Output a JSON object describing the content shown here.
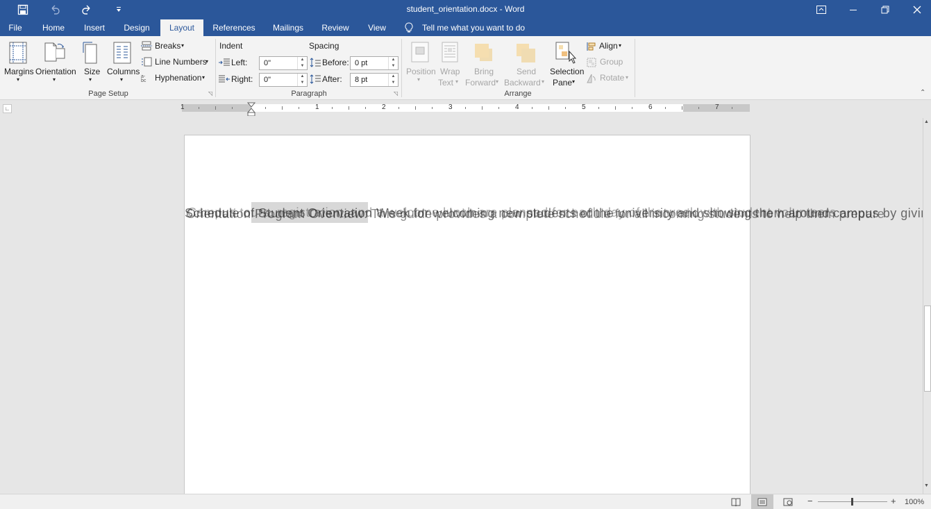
{
  "titlebar": {
    "title": "student_orientation.docx - Word",
    "bg_color": "#2b579a"
  },
  "tabs": [
    "File",
    "Home",
    "Insert",
    "Design",
    "Layout",
    "References",
    "Mailings",
    "Review",
    "View"
  ],
  "active_tab": "Layout",
  "tell_me": "Tell me what you want to do",
  "ribbon": {
    "page_setup": {
      "margins": "Margins",
      "orientation": "Orientation",
      "size": "Size",
      "columns": "Columns",
      "breaks": "Breaks",
      "line_numbers": "Line Numbers",
      "hyphenation": "Hyphenation",
      "label": "Page Setup"
    },
    "paragraph": {
      "indent_label": "Indent",
      "spacing_label": "Spacing",
      "left_label": "Left:",
      "left_value": "0\"",
      "right_label": "Right:",
      "right_value": "0\"",
      "before_label": "Before:",
      "before_value": "0 pt",
      "after_label": "After:",
      "after_value": "8 pt",
      "label": "Paragraph"
    },
    "arrange": {
      "position_1": "Position",
      "wrap_1": "Wrap",
      "wrap_2": "Text",
      "bring_1": "Bring",
      "bring_2": "Forward",
      "send_1": "Send",
      "send_2": "Backward",
      "selection_1": "Selection",
      "selection_2": "Pane",
      "align": "Align",
      "group": "Group",
      "rotate": "Rotate",
      "label": "Arrange"
    }
  },
  "ruler": {
    "numbers": [
      "1",
      "1",
      "2",
      "3",
      "4",
      "5",
      "6",
      "7"
    ]
  },
  "document": {
    "line1": "Schedule of Student Orientation Week for welcoming new students of the university and showing them around campus by giving them",
    "line2": "Orientation Program Overview: This guide provides a complete schedule for all incoming students to help them prepare",
    "line3": "Campus tours, registration, and a welcome lunch are planned for each day of the week with student volunteers"
  },
  "status": {
    "zoom": "100%"
  }
}
